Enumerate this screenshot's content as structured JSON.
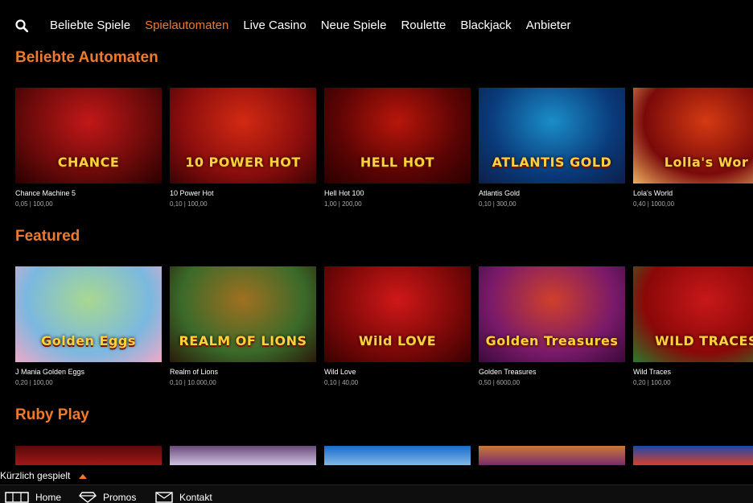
{
  "nav": {
    "items": [
      "Beliebte Spiele",
      "Spielautomaten",
      "Live Casino",
      "Neue Spiele",
      "Roulette",
      "Blackjack",
      "Anbieter"
    ],
    "active": "Spielautomaten"
  },
  "sections": [
    {
      "title": "Beliebte Automaten",
      "games": [
        {
          "name": "Chance Machine 5",
          "stake": "0,05 | 100,00",
          "logo": "CHANCE",
          "colors": [
            "#6b0a0a",
            "#c21818",
            "#2a0000"
          ]
        },
        {
          "name": "10 Power Hot",
          "stake": "0,10 | 100,00",
          "logo": "10 POWER HOT",
          "colors": [
            "#8a0d0d",
            "#d22a12",
            "#3b0303"
          ]
        },
        {
          "name": "Hell Hot 100",
          "stake": "1,00 | 200,00",
          "logo": "HELL HOT",
          "colors": [
            "#5a0404",
            "#b8160b",
            "#2a0000"
          ]
        },
        {
          "name": "Atlantis Gold",
          "stake": "0,10 | 300,00",
          "logo": "ATLANTIS GOLD",
          "colors": [
            "#0a3a7a",
            "#1a8ec8",
            "#0d1f4a"
          ]
        },
        {
          "name": "Lola's World",
          "stake": "0,40 | 1000,00",
          "logo": "Lolla's Wor",
          "colors": [
            "#7a0a0a",
            "#d43a12",
            "#f0b060"
          ]
        }
      ]
    },
    {
      "title": "Featured",
      "games": [
        {
          "name": "J Mania Golden Eggs",
          "stake": "0,20 | 100,00",
          "logo": "Golden Eggs",
          "colors": [
            "#7ab8e0",
            "#a8d890",
            "#f0a8c8"
          ]
        },
        {
          "name": "Realm of Lions",
          "stake": "0,10 | 10.000,00",
          "logo": "REALM OF LIONS",
          "colors": [
            "#3a6a2a",
            "#a07020",
            "#2a1a08"
          ]
        },
        {
          "name": "Wild Love",
          "stake": "0,10 | 40,00",
          "logo": "Wild LOVE",
          "colors": [
            "#7a0808",
            "#d01818",
            "#3a0000"
          ]
        },
        {
          "name": "Golden Treasures",
          "stake": "0,50 | 6000,00",
          "logo": "Golden Treasures",
          "colors": [
            "#7a1a6a",
            "#d0402a",
            "#3a0a3a"
          ]
        },
        {
          "name": "Wild Traces",
          "stake": "0,20 | 100,00",
          "logo": "WILD TRACES",
          "colors": [
            "#8a0808",
            "#c8181a",
            "#2a7a2a"
          ]
        }
      ]
    },
    {
      "title": "Ruby Play",
      "games": [
        {
          "colors": [
            "#5a0a0a",
            "#a01818"
          ]
        },
        {
          "colors": [
            "#6a4a7a",
            "#d0c0e0"
          ]
        },
        {
          "colors": [
            "#1a6ac8",
            "#80b8e8"
          ]
        },
        {
          "colors": [
            "#c87a3a",
            "#7a2a6a"
          ]
        },
        {
          "colors": [
            "#1a4aa8",
            "#d8402a"
          ]
        }
      ]
    }
  ],
  "recent": {
    "label": "Kürzlich gespielt"
  },
  "bottom_nav": {
    "home": "Home",
    "promos": "Promos",
    "kontakt": "Kontakt"
  }
}
